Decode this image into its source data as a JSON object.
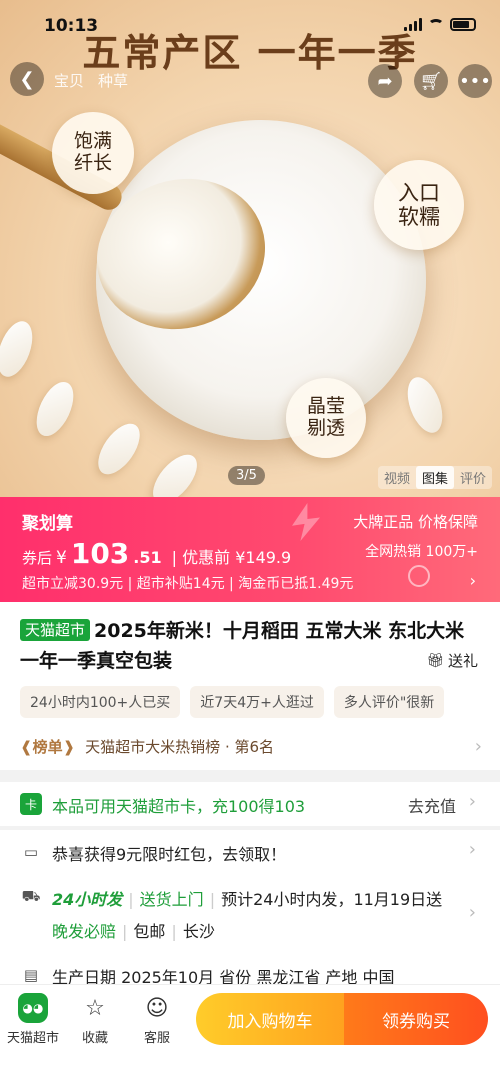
{
  "status_bar": {
    "time": "10:13"
  },
  "hero": {
    "headline": "五常产区 一年一季",
    "nav_tabs": [
      "宝贝",
      "种草"
    ],
    "badges": [
      "饱满\n纤长",
      "入口\n软糯",
      "晶莹\n剔透"
    ],
    "image_counter": "3/5",
    "media_tabs": [
      "视频",
      "图集",
      "评价"
    ],
    "active_media_tab": "图集",
    "accent": "#f3d4ad"
  },
  "price_banner": {
    "brand": "聚划算",
    "guarantee": "大牌正品 价格保障",
    "after_coupon_label": "券后",
    "currency": "¥",
    "price_int": "103",
    "price_dec": ".51",
    "original_label": "| 优惠前 ¥149.9",
    "sales": "全网热销 100万+",
    "promo": "超市立减30.9元 | 超市补贴14元 | 淘金币已抵1.49元",
    "color": "#ff2f6c"
  },
  "product": {
    "store_tag": "天猫超市",
    "title": "2025年新米！十月稻田 五常大米 东北大米 一年一季真空包装",
    "gift": "送礼",
    "chips": [
      "24小时内100+人已买",
      "近7天4万+人逛过",
      "多人评价\"很新"
    ],
    "rank_badge": "榜单",
    "rank_text": "天猫超市大米热销榜 · 第6名"
  },
  "rows": {
    "card_text": "本品可用天猫超市卡，充100得103",
    "card_action": "去充值",
    "redpacket_text": "恭喜获得9元限时红包，去领取！",
    "delivery_tag": "24小时发",
    "delivery_door": "送货上门",
    "delivery_eta": "预计24小时内发，11月19日送",
    "delivery_line2_a": "晚发必赔",
    "delivery_line2_b": "包邮",
    "delivery_line2_c": "长沙",
    "info_text": "生产日期 2025年10月  省份 黑龙江省  产地 中国"
  },
  "bottom_bar": {
    "store": "天猫超市",
    "favorite": "收藏",
    "service": "客服",
    "add_to_cart": "加入购物车",
    "buy": "领券购买"
  }
}
